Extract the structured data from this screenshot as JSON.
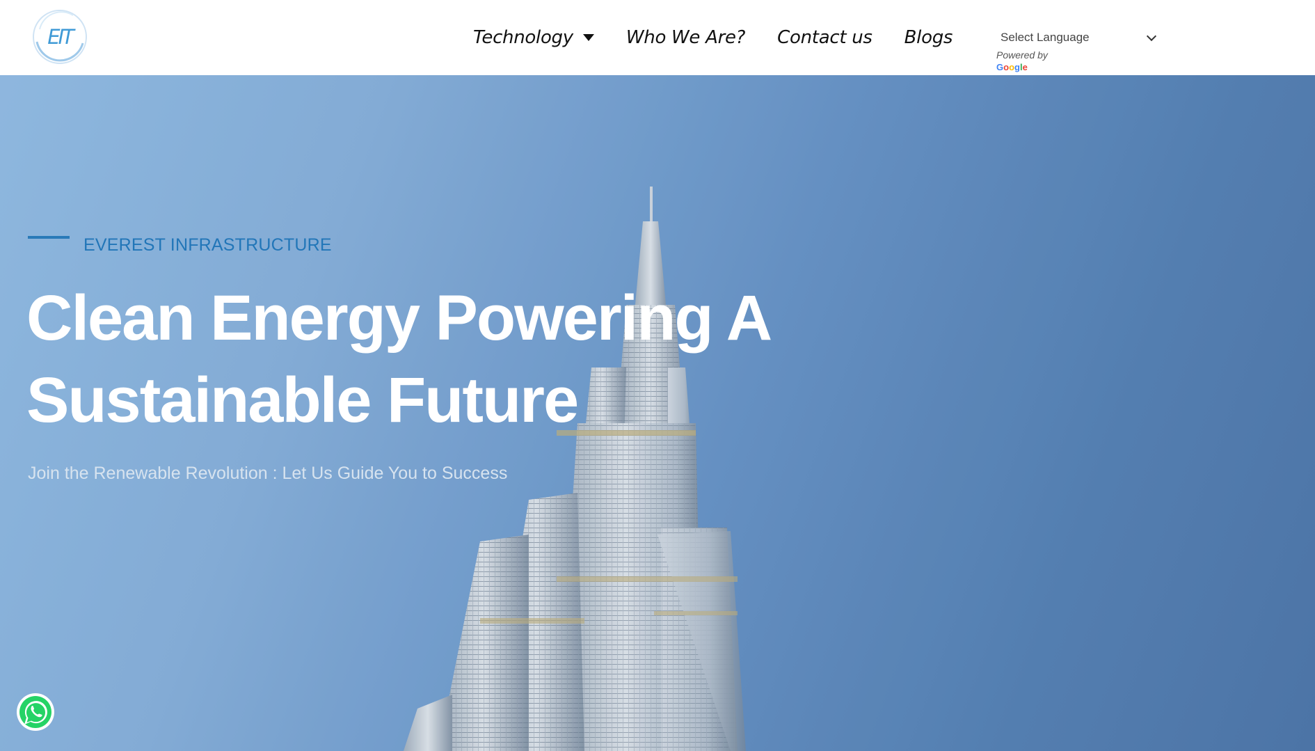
{
  "header": {
    "logo_text": "EIT",
    "nav": [
      {
        "label": "Technology",
        "has_dropdown": true
      },
      {
        "label": "Who We Are?"
      },
      {
        "label": "Contact us"
      },
      {
        "label": "Blogs"
      }
    ],
    "language_select": {
      "selected": "Select Language",
      "powered_by": "Powered by",
      "provider": "Google"
    }
  },
  "hero": {
    "eyebrow": "EVEREST INFRASTRUCTURE",
    "headline_line1": "Clean Energy Powering A",
    "headline_line2": "Sustainable Future",
    "tagline": "Join the Renewable Revolution : Let Us Guide You to Success"
  },
  "floating": {
    "whatsapp_icon": "whatsapp-icon"
  },
  "colors": {
    "accent": "#2276b8",
    "sky_light": "#8ab4dd",
    "sky_dark": "#456fa3",
    "whatsapp_green": "#25d366"
  }
}
